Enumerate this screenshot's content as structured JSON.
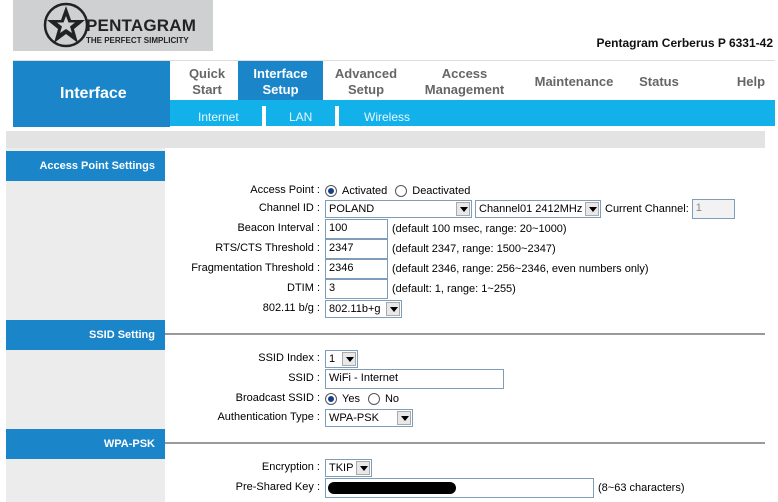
{
  "logo": {
    "name": "PENTAGRAM",
    "tagline": "THE PERFECT SIMPLICITY"
  },
  "model": "Pentagram Cerberus P 6331-42",
  "nav": {
    "section": "Interface",
    "items": [
      {
        "line1": "Quick",
        "line2": "Start"
      },
      {
        "line1": "Interface",
        "line2": "Setup"
      },
      {
        "line1": "Advanced",
        "line2": "Setup"
      },
      {
        "line1": "Access",
        "line2": "Management"
      },
      {
        "line1": "Maintenance"
      },
      {
        "line1": "Status"
      },
      {
        "line1": "Help"
      }
    ],
    "sub": [
      "Internet",
      "LAN",
      "Wireless"
    ]
  },
  "sections": {
    "ap": "Access Point Settings",
    "ssid": "SSID Setting",
    "wpa": "WPA-PSK"
  },
  "ap": {
    "access_point_label": "Access Point :",
    "activated": "Activated",
    "deactivated": "Deactivated",
    "channel_label": "Channel ID :",
    "country": "POLAND",
    "channel": "Channel01 2412MHz",
    "current_channel_label": "Current Channel:",
    "current_channel": "1",
    "beacon_label": "Beacon Interval :",
    "beacon_value": "100",
    "beacon_hint": "(default 100 msec, range: 20~1000)",
    "rts_label": "RTS/CTS Threshold :",
    "rts_value": "2347",
    "rts_hint": "(default 2347, range: 1500~2347)",
    "frag_label": "Fragmentation Threshold :",
    "frag_value": "2346",
    "frag_hint": "(default 2346, range: 256~2346, even numbers only)",
    "dtim_label": "DTIM :",
    "dtim_value": "3",
    "dtim_hint": "(default: 1, range: 1~255)",
    "mode_label": "802.11 b/g :",
    "mode_value": "802.11b+g"
  },
  "ssid": {
    "index_label": "SSID Index :",
    "index_value": "1",
    "ssid_label": "SSID :",
    "ssid_value": "WiFi - Internet",
    "broadcast_label": "Broadcast SSID :",
    "yes": "Yes",
    "no": "No",
    "auth_label": "Authentication Type :",
    "auth_value": "WPA-PSK"
  },
  "wpa": {
    "enc_label": "Encryption :",
    "enc_value": "TKIP",
    "psk_label": "Pre-Shared Key :",
    "psk_hint": "(8~63 characters)"
  },
  "colors": {
    "primary": "#1a85c9",
    "subbar": "#13b1ea",
    "panel": "#ececec"
  }
}
